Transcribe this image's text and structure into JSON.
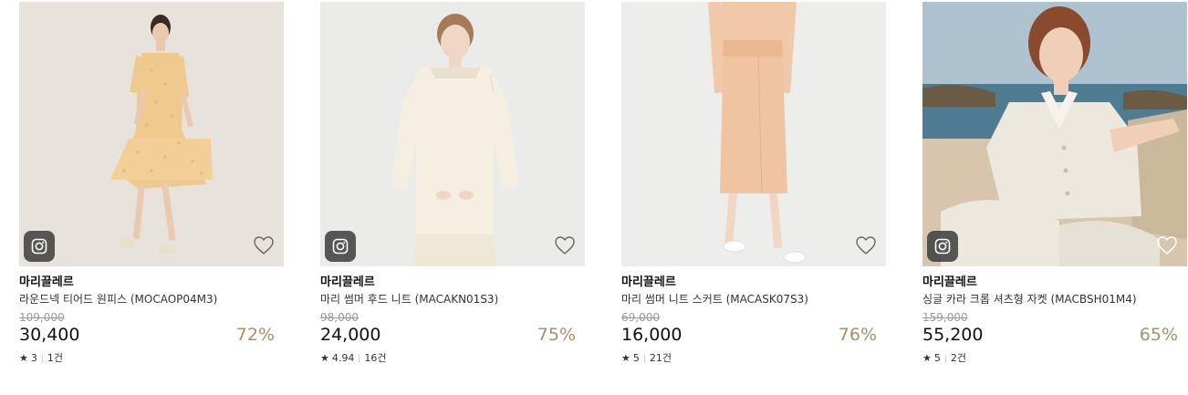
{
  "icons": {
    "instagram": "instagram-icon",
    "wishlist": "heart-icon",
    "rating": "star-icon"
  },
  "colors": {
    "discount": "#a3916a",
    "original_price": "#999999"
  },
  "products": [
    {
      "brand": "마리끌레르",
      "name": "라운드넥 티어드 원피스 (MOCAOP04M3)",
      "original_price": "109,000",
      "price": "30,400",
      "discount": "72%",
      "rating_star": "★",
      "rating": "3",
      "review_count": "1건",
      "has_instagram": true
    },
    {
      "brand": "마리끌레르",
      "name": "마리 썸머 후드 니트 (MACAKN01S3)",
      "original_price": "98,000",
      "price": "24,000",
      "discount": "75%",
      "rating_star": "★",
      "rating": "4.94",
      "review_count": "16건",
      "has_instagram": true
    },
    {
      "brand": "마리끌레르",
      "name": "마리 썸머 니트 스커트 (MACASK07S3)",
      "original_price": "69,000",
      "price": "16,000",
      "discount": "76%",
      "rating_star": "★",
      "rating": "5",
      "review_count": "21건",
      "has_instagram": false
    },
    {
      "brand": "마리끌레르",
      "name": "싱글 카라 크롭 셔츠형 자켓 (MACBSH01M4)",
      "original_price": "159,000",
      "price": "55,200",
      "discount": "65%",
      "rating_star": "★",
      "rating": "5",
      "review_count": "2건",
      "has_instagram": true
    }
  ]
}
